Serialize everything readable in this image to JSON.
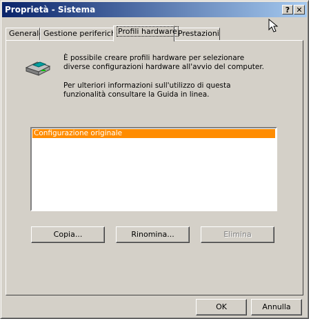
{
  "window": {
    "title": "Proprietà - Sistema",
    "help_button": "?",
    "close_button": "✕"
  },
  "tabs": [
    {
      "label": "Generale"
    },
    {
      "label": "Gestione periferiche"
    },
    {
      "label": "Profili hardware"
    },
    {
      "label": "Prestazioni"
    }
  ],
  "active_tab": "Profili hardware",
  "content": {
    "description": "È possibile creare profili hardware per selezionare diverse configurazioni hardware all'avvio del computer.",
    "info": "Per ulteriori informazioni sull'utilizzo di questa funzionalità consultare la Guida in linea."
  },
  "profiles": [
    {
      "label": "Configurazione originale",
      "selected": true
    }
  ],
  "actions": {
    "copy": "Copia...",
    "rename": "Rinomina...",
    "delete": "Elimina"
  },
  "footer": {
    "ok": "OK",
    "cancel": "Annulla"
  },
  "colors": {
    "selection": "#ff8c00",
    "titlebar_start": "#0a246a",
    "titlebar_end": "#a6caf0",
    "face": "#d4d0c8"
  }
}
